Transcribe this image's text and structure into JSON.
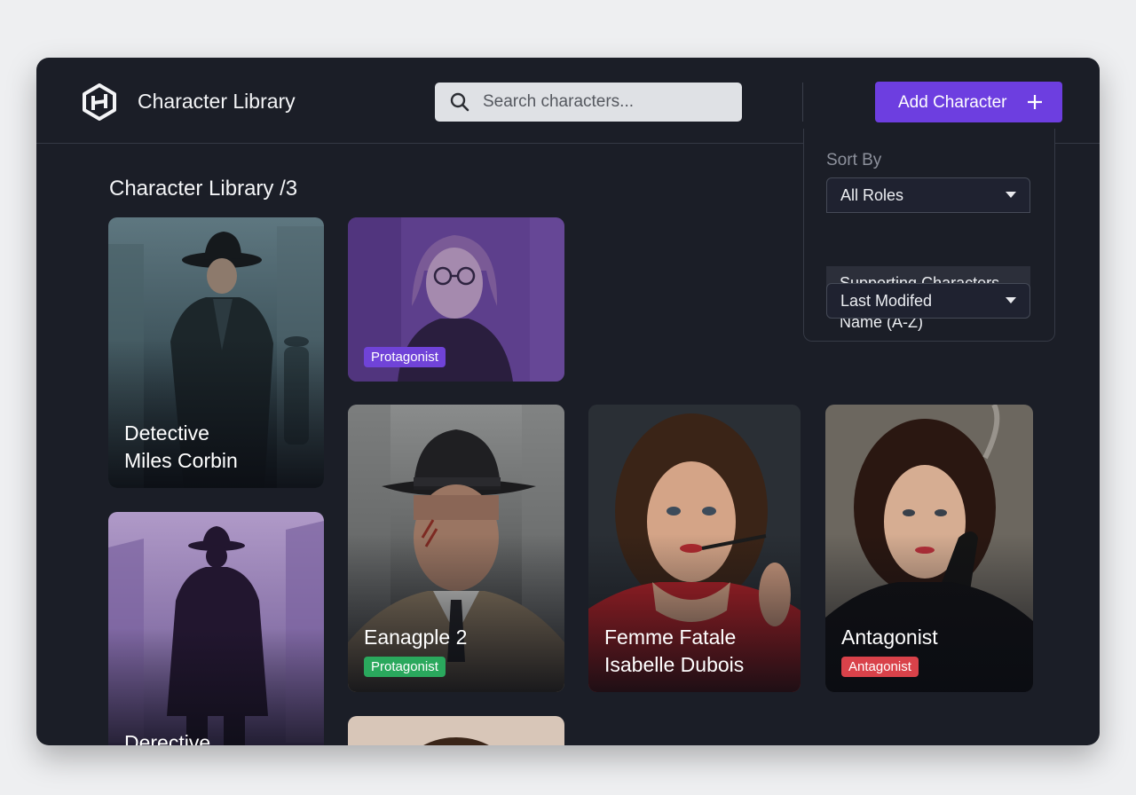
{
  "header": {
    "app_title": "Character Library",
    "search_placeholder": "Search characters...",
    "add_button_label": "Add Character"
  },
  "main": {
    "section_title": "Character Library /3",
    "cards": [
      {
        "name_line1": "Detective",
        "name_line2": "Miles Corbin",
        "badge": null
      },
      {
        "name_line1": "",
        "name_line2": "",
        "badge": "Protagonist",
        "badge_color": "#7043d8"
      },
      {
        "name_line1": "Eanagple 2",
        "name_line2": "",
        "badge": "Protagonist",
        "badge_color": "#2aa85d"
      },
      {
        "name_line1": "Femme Fatale",
        "name_line2": "Isabelle Dubois",
        "badge": null
      },
      {
        "name_line1": "Antagonist",
        "name_line2": "",
        "badge": "Antagonist",
        "badge_color": "#d9424a"
      },
      {
        "name_line1": "Derective",
        "name_line2": "",
        "badge": null
      }
    ]
  },
  "sort_panel": {
    "label": "Sort By",
    "role_select_value": "All Roles",
    "role_option_highlighted": "Supporting Characters",
    "name_option": "Name (A-Z)",
    "order_select_value": "Last Modifed"
  },
  "colors": {
    "app_background": "#1b1e27",
    "accent": "#6d3ee0",
    "badge_protagonist_purple": "#7043d8",
    "badge_protagonist_green": "#2aa85d",
    "badge_antagonist": "#d9424a"
  },
  "icons": [
    "app-logo-icon",
    "search-icon",
    "plus-icon",
    "caret-down-icon"
  ]
}
